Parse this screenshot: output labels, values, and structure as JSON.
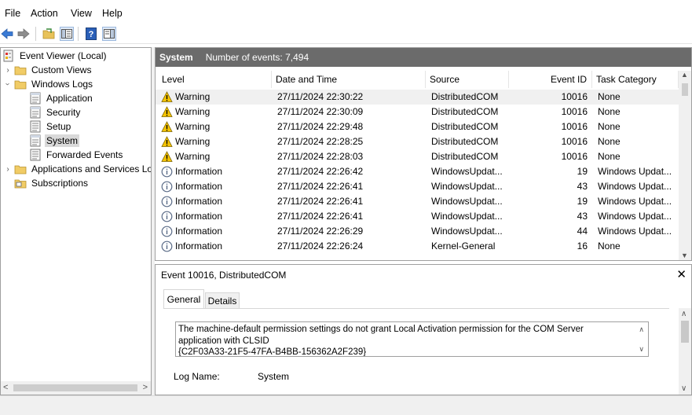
{
  "menu": [
    "File",
    "Action",
    "View",
    "Help"
  ],
  "toolbar": {
    "buttons": [
      "back-arrow-icon",
      "forward-arrow-icon",
      "open-folder-icon",
      "show-hide-tree-icon",
      "help-icon",
      "properties-pane-icon"
    ]
  },
  "tree": {
    "root": "Event Viewer (Local)",
    "custom_views": "Custom Views",
    "windows_logs": "Windows Logs",
    "logs": [
      "Application",
      "Security",
      "Setup",
      "System",
      "Forwarded Events"
    ],
    "apps_services": "Applications and Services Lo",
    "subscriptions": "Subscriptions",
    "selected": "System"
  },
  "events_pane": {
    "title": "System",
    "count_label": "Number of events: 7,494",
    "columns": [
      "Level",
      "Date and Time",
      "Source",
      "Event ID",
      "Task Category"
    ],
    "rows": [
      {
        "level": "Warning",
        "datetime": "27/11/2024 22:30:22",
        "source": "DistributedCOM",
        "id": "10016",
        "category": "None"
      },
      {
        "level": "Warning",
        "datetime": "27/11/2024 22:30:09",
        "source": "DistributedCOM",
        "id": "10016",
        "category": "None"
      },
      {
        "level": "Warning",
        "datetime": "27/11/2024 22:29:48",
        "source": "DistributedCOM",
        "id": "10016",
        "category": "None"
      },
      {
        "level": "Warning",
        "datetime": "27/11/2024 22:28:25",
        "source": "DistributedCOM",
        "id": "10016",
        "category": "None"
      },
      {
        "level": "Warning",
        "datetime": "27/11/2024 22:28:03",
        "source": "DistributedCOM",
        "id": "10016",
        "category": "None"
      },
      {
        "level": "Information",
        "datetime": "27/11/2024 22:26:42",
        "source": "WindowsUpdat...",
        "id": "19",
        "category": "Windows Updat..."
      },
      {
        "level": "Information",
        "datetime": "27/11/2024 22:26:41",
        "source": "WindowsUpdat...",
        "id": "43",
        "category": "Windows Updat..."
      },
      {
        "level": "Information",
        "datetime": "27/11/2024 22:26:41",
        "source": "WindowsUpdat...",
        "id": "19",
        "category": "Windows Updat..."
      },
      {
        "level": "Information",
        "datetime": "27/11/2024 22:26:41",
        "source": "WindowsUpdat...",
        "id": "43",
        "category": "Windows Updat..."
      },
      {
        "level": "Information",
        "datetime": "27/11/2024 22:26:29",
        "source": "WindowsUpdat...",
        "id": "44",
        "category": "Windows Updat..."
      },
      {
        "level": "Information",
        "datetime": "27/11/2024 22:26:24",
        "source": "Kernel-General",
        "id": "16",
        "category": "None"
      }
    ]
  },
  "detail": {
    "title": "Event 10016, DistributedCOM",
    "tabs": [
      "General",
      "Details"
    ],
    "active_tab": "General",
    "message_line1": "The machine-default permission settings do not grant Local Activation permission for the COM Server",
    "message_line2": "application with CLSID",
    "message_line3": "{C2F03A33-21F5-47FA-B4BB-156362A2F239}",
    "log_name_label": "Log Name:",
    "log_name_value": "System"
  },
  "colors": {
    "header_bar": "#6b6b6b",
    "selection": "#d9d9d9",
    "warning": "#f5c400",
    "info": "#5a6b87"
  }
}
